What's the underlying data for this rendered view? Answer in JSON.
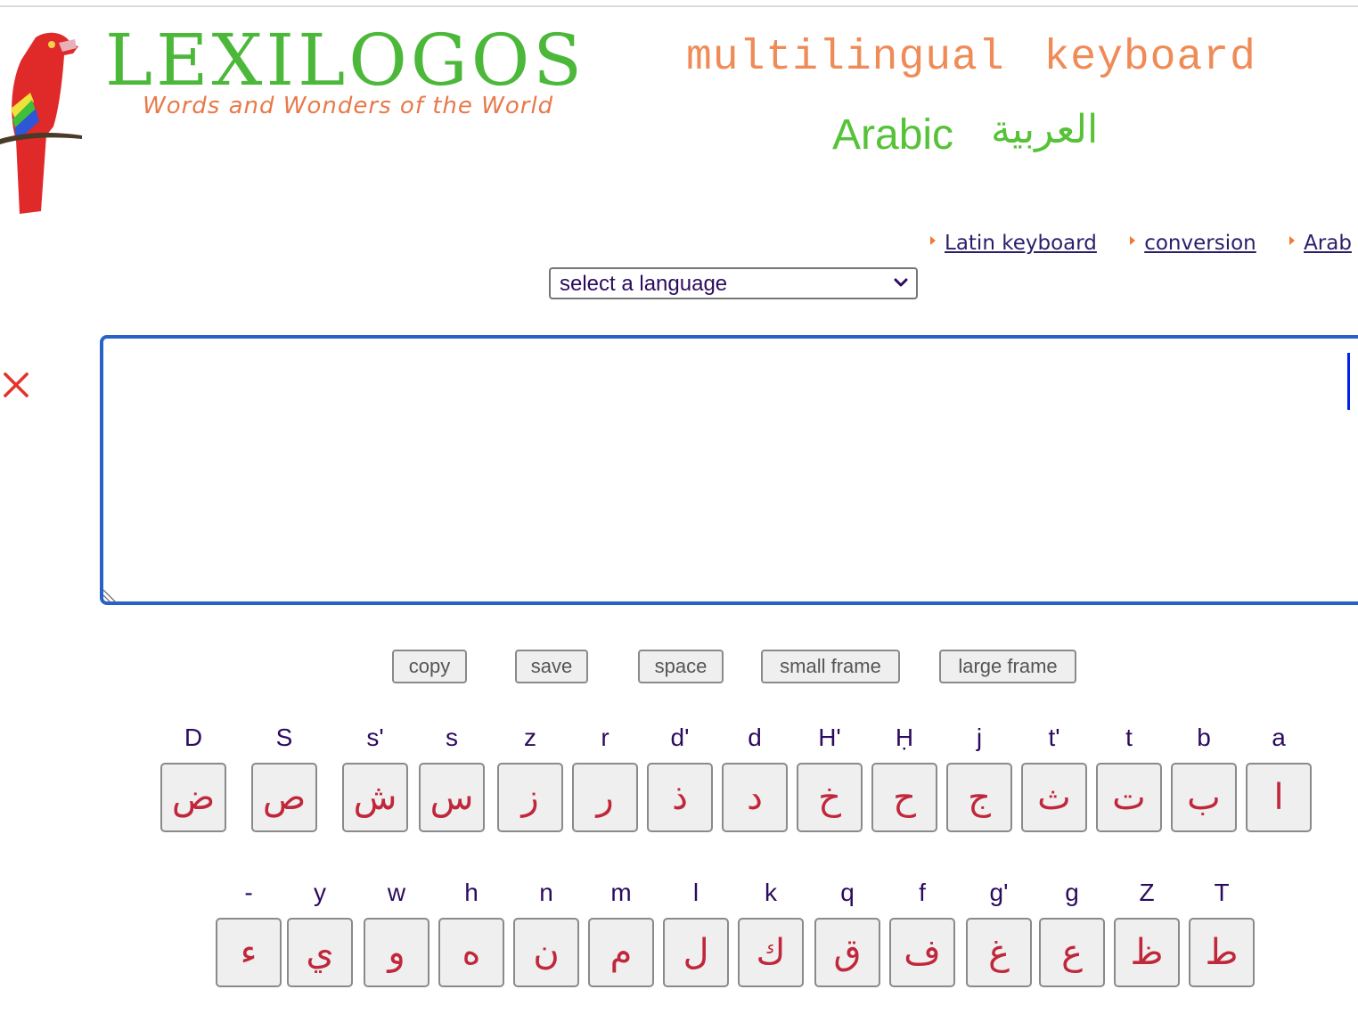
{
  "header": {
    "logo_title": "LEXILOGOS",
    "logo_tagline": "Words and Wonders of the World",
    "page_title": "multilingual keyboard",
    "language_en": "Arabic",
    "language_native": "العربية"
  },
  "nav_links": [
    {
      "label": "Latin keyboard"
    },
    {
      "label": "conversion"
    },
    {
      "label": "Arab"
    }
  ],
  "language_select": {
    "selected": "select a language"
  },
  "editor": {
    "value": ""
  },
  "buttons": {
    "copy": "copy",
    "save": "save",
    "space": "space",
    "small_frame": "small frame",
    "large_frame": "large frame"
  },
  "colors": {
    "logo_green": "#4cb83a",
    "title_orange": "#ef8b56",
    "key_char": "#c0273a",
    "key_label": "#2c0b5e",
    "textarea_border": "#2762c6"
  },
  "keyboard": {
    "row1": [
      {
        "label": "D",
        "char": "ض"
      },
      {
        "label": "S",
        "char": "ص"
      },
      {
        "label": "s'",
        "char": "ش"
      },
      {
        "label": "s",
        "char": "س"
      },
      {
        "label": "z",
        "char": "ز"
      },
      {
        "label": "r",
        "char": "ر"
      },
      {
        "label": "d'",
        "char": "ذ"
      },
      {
        "label": "d",
        "char": "د"
      },
      {
        "label": "H'",
        "char": "خ"
      },
      {
        "label": "Ḥ",
        "char": "ح"
      },
      {
        "label": "j",
        "char": "ج"
      },
      {
        "label": "t'",
        "char": "ث"
      },
      {
        "label": "t",
        "char": "ت"
      },
      {
        "label": "b",
        "char": "ب"
      },
      {
        "label": "a",
        "char": "ا"
      }
    ],
    "row2": [
      {
        "label": "-",
        "char": "ء"
      },
      {
        "label": "y",
        "char": "ي"
      },
      {
        "label": "w",
        "char": "و"
      },
      {
        "label": "h",
        "char": "ه"
      },
      {
        "label": "n",
        "char": "ن"
      },
      {
        "label": "m",
        "char": "م"
      },
      {
        "label": "l",
        "char": "ل"
      },
      {
        "label": "k",
        "char": "ك"
      },
      {
        "label": "q",
        "char": "ق"
      },
      {
        "label": "f",
        "char": "ف"
      },
      {
        "label": "g'",
        "char": "غ"
      },
      {
        "label": "g",
        "char": "ع"
      },
      {
        "label": "Z",
        "char": "ظ"
      },
      {
        "label": "T",
        "char": "ط"
      }
    ]
  }
}
